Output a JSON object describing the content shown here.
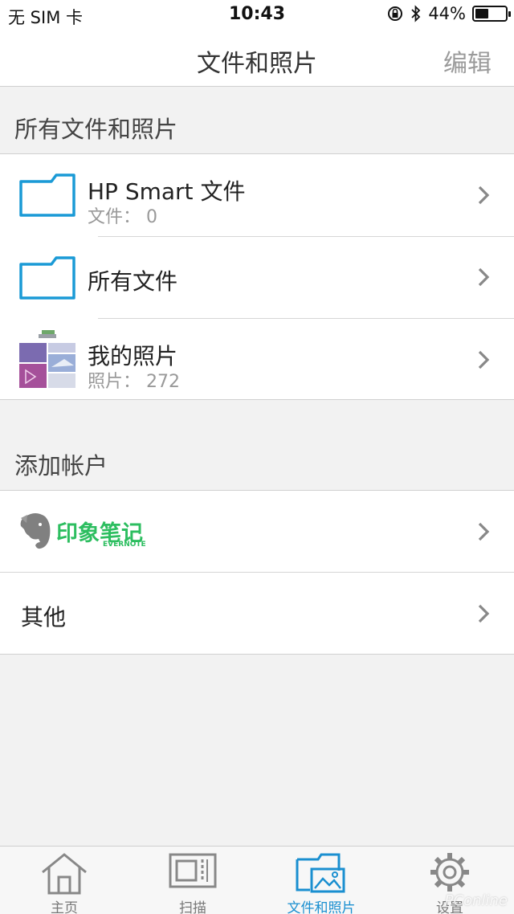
{
  "status": {
    "carrier": "无 SIM 卡",
    "time": "10:43",
    "battery_percent": "44%",
    "battery_level": 0.44
  },
  "nav": {
    "title": "文件和照片",
    "edit_label": "编辑"
  },
  "sections": {
    "files_header": "所有文件和照片",
    "accounts_header": "添加帐户"
  },
  "files": [
    {
      "title": "HP Smart 文件",
      "subtitle": "文件：  0",
      "icon": "folder-icon"
    },
    {
      "title": "所有文件",
      "subtitle": "",
      "icon": "folder-icon"
    },
    {
      "title": "我的照片",
      "subtitle": "照片：  272",
      "icon": "photo-thumbnail"
    }
  ],
  "accounts": {
    "evernote_name": "印象笔记",
    "evernote_sub": "EVERNOTE",
    "other_label": "其他"
  },
  "tabs": [
    {
      "label": "主页",
      "icon": "home-icon",
      "active": false
    },
    {
      "label": "扫描",
      "icon": "scan-icon",
      "active": false
    },
    {
      "label": "文件和照片",
      "icon": "files-photos-icon",
      "active": true
    },
    {
      "label": "设置",
      "icon": "gear-icon",
      "active": false
    }
  ],
  "watermark": "PConline",
  "colors": {
    "accent": "#1a8fd0",
    "folder": "#1a9ad6",
    "evernote_green": "#2dbe60"
  }
}
